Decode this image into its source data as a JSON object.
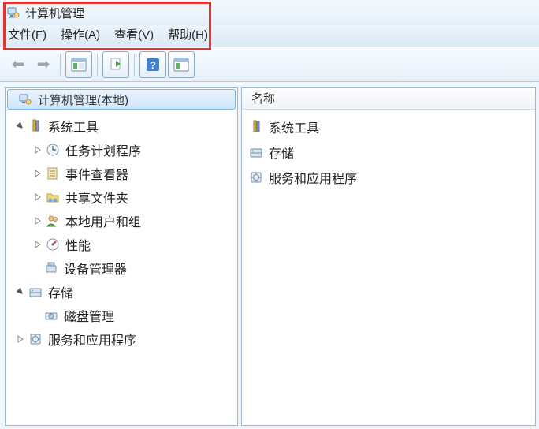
{
  "title": "计算机管理",
  "menu": {
    "file": "文件(F)",
    "action": "操作(A)",
    "view": "查看(V)",
    "help": "帮助(H)"
  },
  "tree": {
    "root": "计算机管理(本地)",
    "system_tools": "系统工具",
    "task_scheduler": "任务计划程序",
    "event_viewer": "事件查看器",
    "shared_folders": "共享文件夹",
    "local_users": "本地用户和组",
    "performance": "性能",
    "device_manager": "设备管理器",
    "storage": "存储",
    "disk_mgmt": "磁盘管理",
    "services_apps": "服务和应用程序"
  },
  "list": {
    "header": "名称",
    "system_tools": "系统工具",
    "storage": "存储",
    "services_apps": "服务和应用程序"
  }
}
